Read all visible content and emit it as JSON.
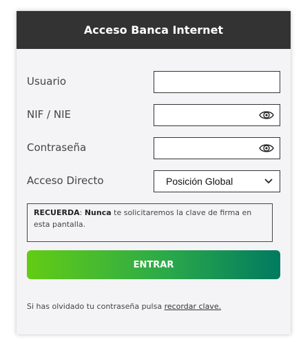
{
  "header": {
    "title": "Acceso Banca Internet"
  },
  "form": {
    "usuario_label": "Usuario",
    "usuario_value": "",
    "nif_label": "NIF / NIE",
    "nif_value": "",
    "password_label": "Contraseña",
    "password_value": "",
    "direct_access_label": "Acceso Directo",
    "direct_access_selected": "Posición Global"
  },
  "notice": {
    "emphasis": "RECUERDA",
    "separator": ": ",
    "strong_word": "Nunca",
    "text": " te solicitaremos la clave de firma en esta pantalla."
  },
  "enter_button": {
    "label": "ENTRAR"
  },
  "forgot": {
    "text": "Si has olvidado tu contraseña pulsa ",
    "link": "recordar clave."
  },
  "colors": {
    "header_bg": "#333333",
    "button_gradient_start": "#63cc14",
    "button_gradient_end": "#007a60"
  },
  "icons": {
    "eye": "eye-icon",
    "chevron": "chevron-down-icon"
  }
}
